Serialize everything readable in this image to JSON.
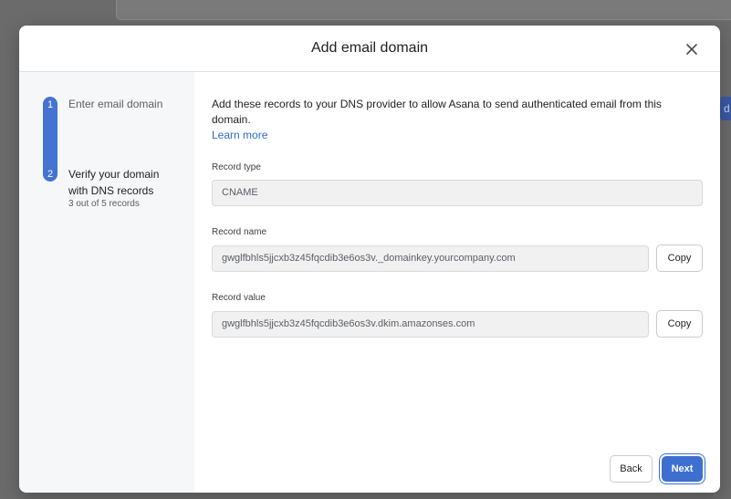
{
  "background": {
    "pill_text": "d e"
  },
  "modal": {
    "title": "Add email domain",
    "close_icon": "close-icon"
  },
  "steps": [
    {
      "number": "1",
      "label": "Enter email domain"
    },
    {
      "number": "2",
      "label_line1": "Verify your domain",
      "label_line2": "with DNS records",
      "sub": "3 out of 5 records"
    }
  ],
  "content": {
    "intro": "Add these records to your DNS provider to allow Asana to send authenticated email from this domain.",
    "learn_more": "Learn more",
    "fields": {
      "record_type": {
        "label": "Record type",
        "value": "CNAME"
      },
      "record_name": {
        "label": "Record name",
        "value": "gwglfbhls5jjcxb3z45fqcdib3e6os3v._domainkey.yourcompany.com",
        "copy_label": "Copy"
      },
      "record_value": {
        "label": "Record value",
        "value": "gwglfbhls5jjcxb3z45fqcdib3e6os3v.dkim.amazonses.com",
        "copy_label": "Copy"
      }
    }
  },
  "footer": {
    "back_label": "Back",
    "next_label": "Next"
  },
  "colors": {
    "accent": "#4573d2",
    "link": "#3269c7",
    "primary_button": "#3d6fd1"
  }
}
